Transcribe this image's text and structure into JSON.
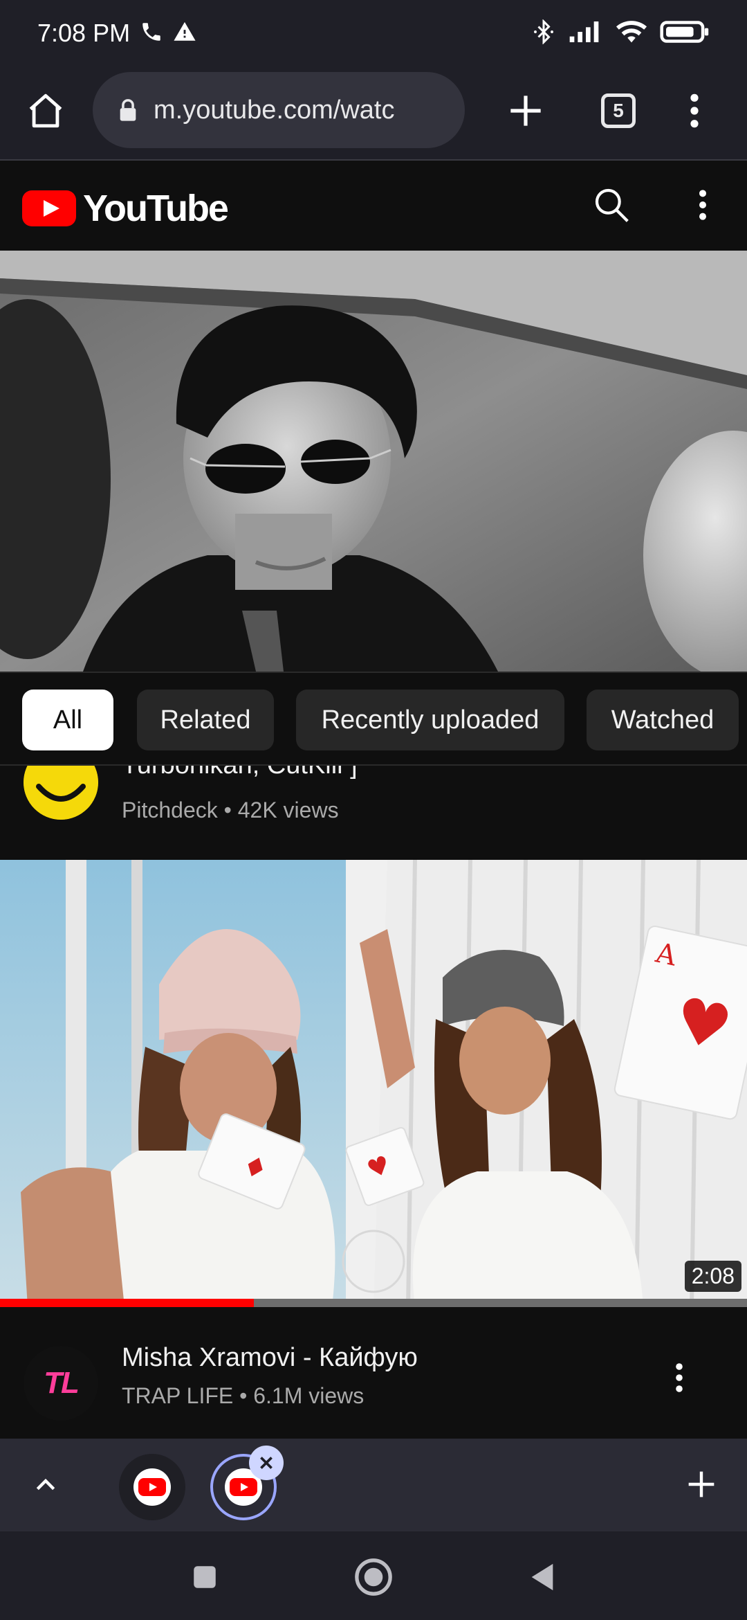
{
  "status_bar": {
    "time": "7:08 PM"
  },
  "browser": {
    "url": "m.youtube.com/watc",
    "tab_count": "5"
  },
  "youtube": {
    "logo_text": "YouTube"
  },
  "chips": [
    {
      "label": "All",
      "active": true
    },
    {
      "label": "Related",
      "active": false
    },
    {
      "label": "Recently uploaded",
      "active": false
    },
    {
      "label": "Watched",
      "active": false
    }
  ],
  "partial_item": {
    "title": "Turbonikan, CutKill ]",
    "channel": "Pitchdeck",
    "views": "42K views"
  },
  "video": {
    "duration": "2:08",
    "progress": 0.34,
    "title": "Misha Xramovi - Кайфую",
    "channel": "TRAP LIFE",
    "views": "6.1M views",
    "channel_avatar_text": "TL"
  },
  "colors": {
    "accent_red": "#ff0000",
    "chrome_bg": "#1f1f27",
    "page_bg": "#0f0f0f",
    "tab_group_bg": "#2b2b35"
  },
  "icons": {
    "call": "phone-icon",
    "alert": "warning-icon",
    "bluetooth": "bluetooth-icon",
    "signal": "signal-icon",
    "wifi": "wifi-icon",
    "battery": "battery-icon",
    "home": "home-icon",
    "lock": "lock-icon",
    "new_tab": "plus-icon",
    "menu": "more-vert-icon",
    "search": "search-icon"
  }
}
